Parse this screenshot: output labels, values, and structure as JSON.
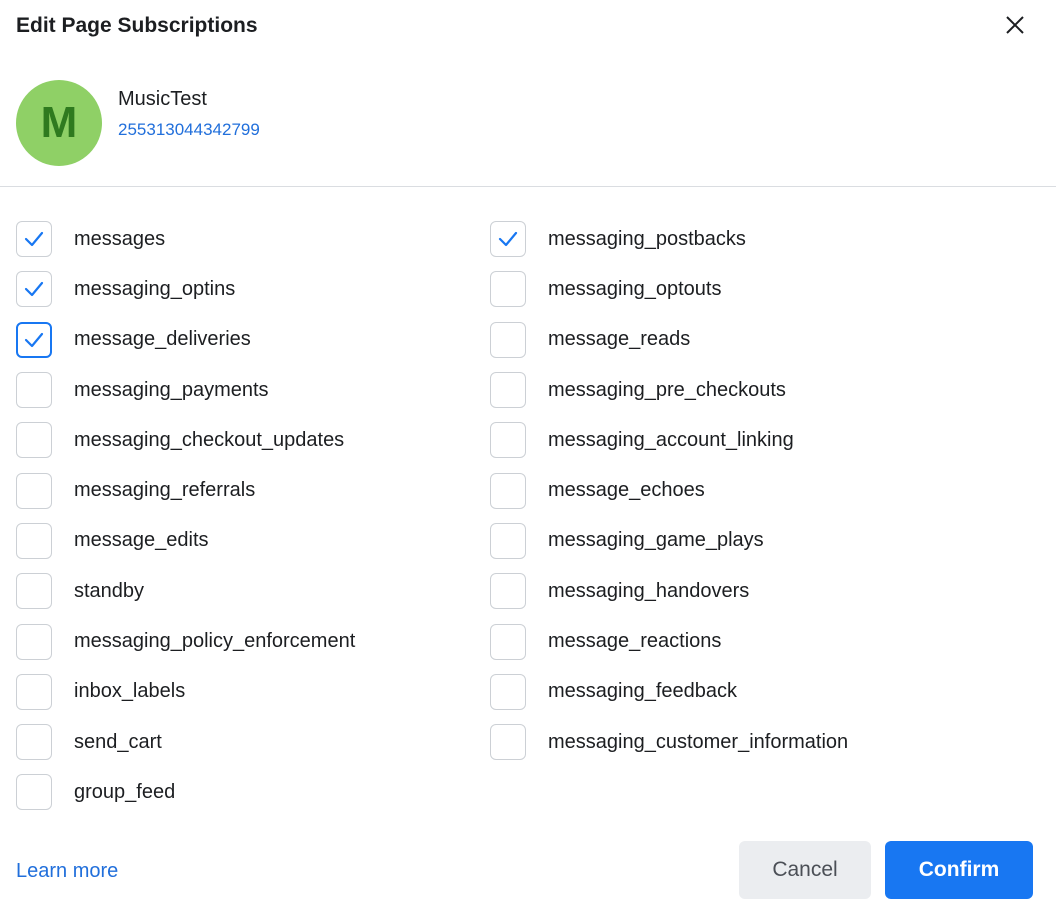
{
  "dialog": {
    "title": "Edit Page Subscriptions",
    "close_icon": "close-icon"
  },
  "page": {
    "avatar_letter": "M",
    "avatar_color": "#8fd066",
    "name": "MusicTest",
    "id": "255313044342799"
  },
  "subscriptions": {
    "left": [
      {
        "label": "messages",
        "checked": true
      },
      {
        "label": "messaging_optins",
        "checked": true
      },
      {
        "label": "message_deliveries",
        "checked": true,
        "focused": true
      },
      {
        "label": "messaging_payments",
        "checked": false
      },
      {
        "label": "messaging_checkout_updates",
        "checked": false
      },
      {
        "label": "messaging_referrals",
        "checked": false
      },
      {
        "label": "message_edits",
        "checked": false
      },
      {
        "label": "standby",
        "checked": false
      },
      {
        "label": "messaging_policy_enforcement",
        "checked": false
      },
      {
        "label": "inbox_labels",
        "checked": false
      },
      {
        "label": "send_cart",
        "checked": false
      },
      {
        "label": "group_feed",
        "checked": false
      }
    ],
    "right": [
      {
        "label": "messaging_postbacks",
        "checked": true
      },
      {
        "label": "messaging_optouts",
        "checked": false
      },
      {
        "label": "message_reads",
        "checked": false
      },
      {
        "label": "messaging_pre_checkouts",
        "checked": false
      },
      {
        "label": "messaging_account_linking",
        "checked": false
      },
      {
        "label": "message_echoes",
        "checked": false
      },
      {
        "label": "messaging_game_plays",
        "checked": false
      },
      {
        "label": "messaging_handovers",
        "checked": false
      },
      {
        "label": "message_reactions",
        "checked": false
      },
      {
        "label": "messaging_feedback",
        "checked": false
      },
      {
        "label": "messaging_customer_information",
        "checked": false
      }
    ]
  },
  "footer": {
    "learn_more": "Learn more",
    "cancel_label": "Cancel",
    "confirm_label": "Confirm"
  },
  "colors": {
    "accent": "#1877f2",
    "link": "#216fdb",
    "checkmark": "#1877f2"
  }
}
